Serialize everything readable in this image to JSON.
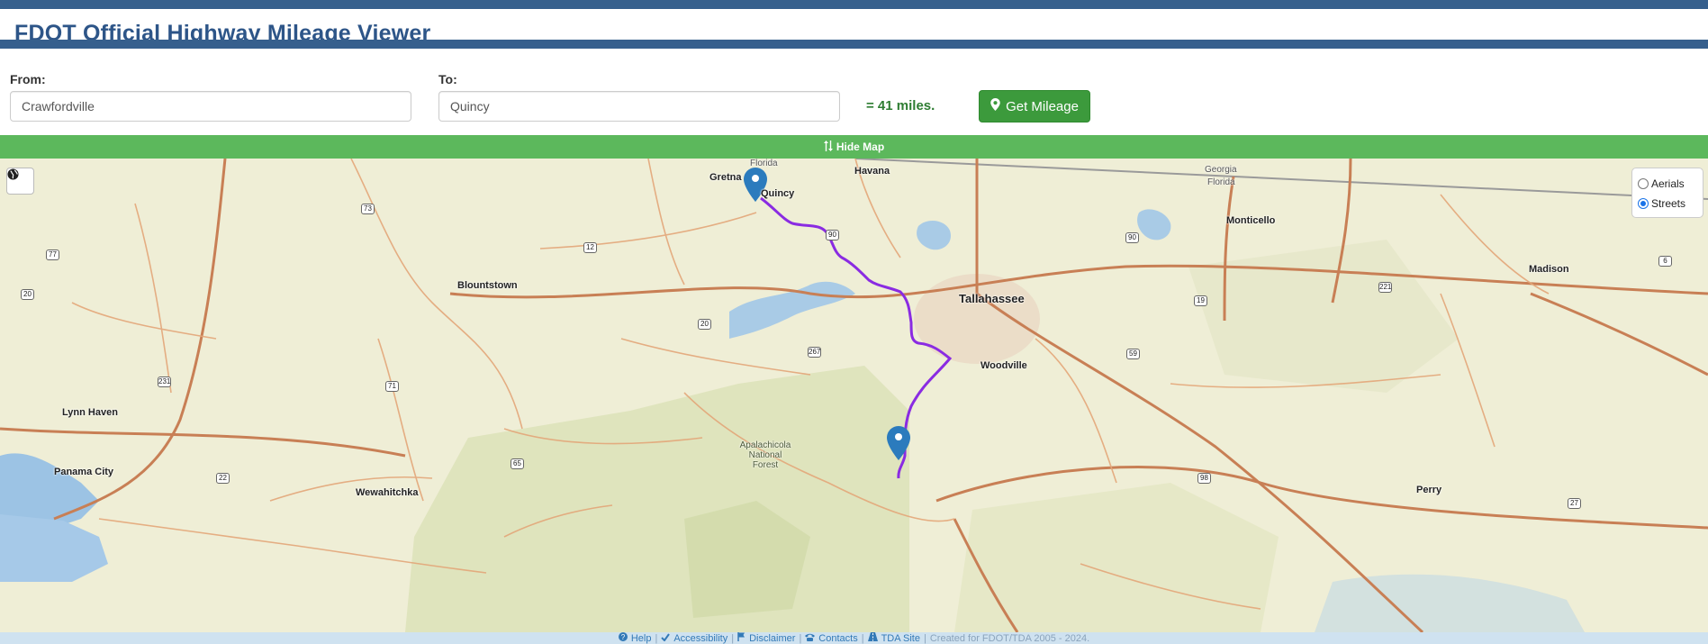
{
  "header": {
    "title": "FDOT Official Highway Mileage Viewer"
  },
  "form": {
    "from_label": "From:",
    "from_value": "Crawfordville",
    "to_label": "To:",
    "to_value": "Quincy",
    "result": "= 41 miles.",
    "button_label": "Get Mileage"
  },
  "toggle": {
    "hide_map_label": "Hide Map"
  },
  "layers": {
    "options": [
      {
        "label": "Aerials",
        "selected": false
      },
      {
        "label": "Streets",
        "selected": true
      }
    ]
  },
  "map": {
    "places": {
      "florida_top": "Florida",
      "georgia": "Georgia",
      "florida_right": "Florida",
      "gretna": "Gretna",
      "quincy": "Quincy",
      "havana": "Havana",
      "monticello": "Monticello",
      "blountstown": "Blountstown",
      "tallahassee": "Tallahassee",
      "madison": "Madison",
      "woodville": "Woodville",
      "lynn_haven": "Lynn Haven",
      "panama_city": "Panama City",
      "wewahitchka": "Wewahitchka",
      "perry": "Perry",
      "forest_1": "Apalachicola",
      "forest_2": "National",
      "forest_3": "Forest"
    },
    "shields": {
      "s73": "73",
      "s77": "77",
      "s12": "12",
      "s90": "90",
      "s6": "6",
      "s20a": "20",
      "s90b": "90",
      "s221": "221",
      "s19": "19",
      "s20b": "20",
      "s267": "267",
      "s59": "59",
      "s231": "231",
      "s71": "71",
      "s22": "22",
      "s65": "65",
      "s98": "98",
      "s27": "27"
    },
    "route_color": "#8a2be2",
    "marker_color": "#2b7bbd"
  },
  "footer": {
    "help": "Help",
    "accessibility": "Accessibility",
    "disclaimer": "Disclaimer",
    "contacts": "Contacts",
    "tda_site": "TDA Site",
    "credit": "Created for FDOT/TDA 2005 - 2024."
  }
}
